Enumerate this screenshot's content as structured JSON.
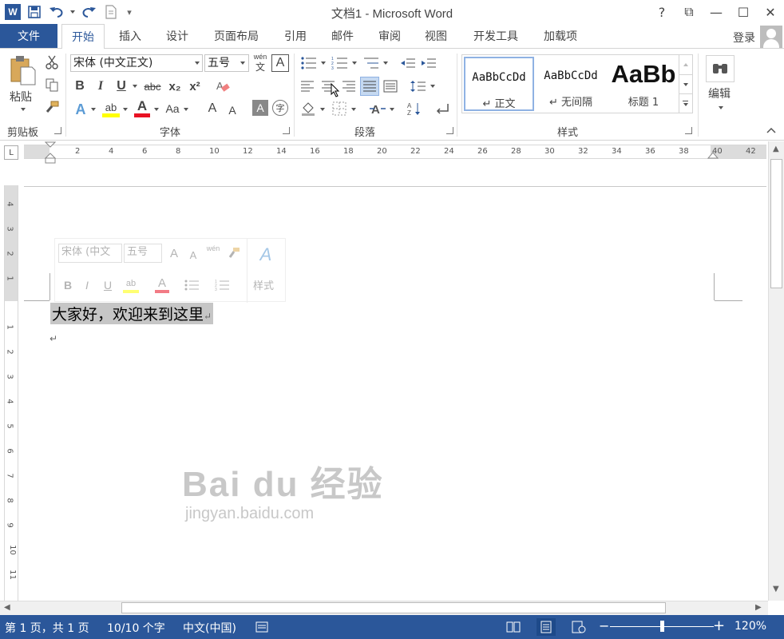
{
  "window": {
    "title": "文档1 - Microsoft Word",
    "app_icon_letter": "W",
    "help": "?",
    "ribbon_display": "⧉",
    "minimize": "—",
    "maximize": "☐",
    "close": "✕"
  },
  "qat": {
    "save_icon": "save-icon",
    "undo_icon": "undo-icon",
    "redo_icon": "redo-icon",
    "new_icon": "new-document-icon",
    "customize": "▾"
  },
  "tabs": {
    "file": "文件",
    "items": [
      "开始",
      "插入",
      "设计",
      "页面布局",
      "引用",
      "邮件",
      "审阅",
      "视图",
      "开发工具",
      "加载项"
    ],
    "active": "开始",
    "login": "登录"
  },
  "ribbon": {
    "clipboard": {
      "label": "剪贴板",
      "paste": "粘贴"
    },
    "font": {
      "label": "字体",
      "font_name": "宋体 (中文正文)",
      "font_size": "五号",
      "wen": "wén",
      "wen_char": "文",
      "boxed_a": "A",
      "bold": "B",
      "italic": "I",
      "underline": "U",
      "strike": "abc",
      "subscript": "x₂",
      "superscript": "x²",
      "text_effects": "A",
      "highlight": "ab",
      "font_color": "A",
      "change_case": "Aa",
      "grow": "A",
      "shrink": "A",
      "char_shading": "A",
      "enclose": "字"
    },
    "paragraph": {
      "label": "段落"
    },
    "styles": {
      "label": "样式",
      "items": [
        {
          "sample": "AaBbCcDd",
          "name": "↵ 正文"
        },
        {
          "sample": "AaBbCcDd",
          "name": "↵ 无间隔"
        },
        {
          "sample": "AaBb",
          "name": "标题 1"
        }
      ]
    },
    "editing": {
      "label": "编辑"
    },
    "accent_color": "#2b579a",
    "highlight_color": "#ffff00",
    "font_color": "#e81123"
  },
  "ruler": {
    "corner": "L",
    "h_ticks": [
      "2",
      "4",
      "6",
      "8",
      "10",
      "12",
      "14",
      "16",
      "18",
      "20",
      "22",
      "24",
      "26",
      "28",
      "30",
      "32",
      "34",
      "36",
      "38",
      "40",
      "42"
    ],
    "v_top_ticks": [
      "4",
      "3",
      "2",
      "1"
    ],
    "v_ticks": [
      "1",
      "2",
      "3",
      "4",
      "5",
      "6",
      "7",
      "8",
      "9",
      "10",
      "11"
    ]
  },
  "mini_toolbar": {
    "font_name": "宋体 (中文",
    "font_size": "五号",
    "grow": "A",
    "shrink": "A",
    "wen": "wén",
    "bold": "B",
    "italic": "I",
    "underline": "U",
    "highlight": "ab",
    "font_color": "A",
    "styles_label": "样式"
  },
  "document": {
    "line1": "大家好，欢迎来到这里",
    "para_mark": "↵"
  },
  "watermark": {
    "brand": "Bai  du 经验",
    "url": "jingyan.baidu.com"
  },
  "status": {
    "page": "第 1 页，共 1 页",
    "words": "10/10 个字",
    "language": "中文(中国)",
    "zoom_minus": "−",
    "zoom_plus": "+",
    "zoom": "120%",
    "zoom_fraction": 0.5
  }
}
